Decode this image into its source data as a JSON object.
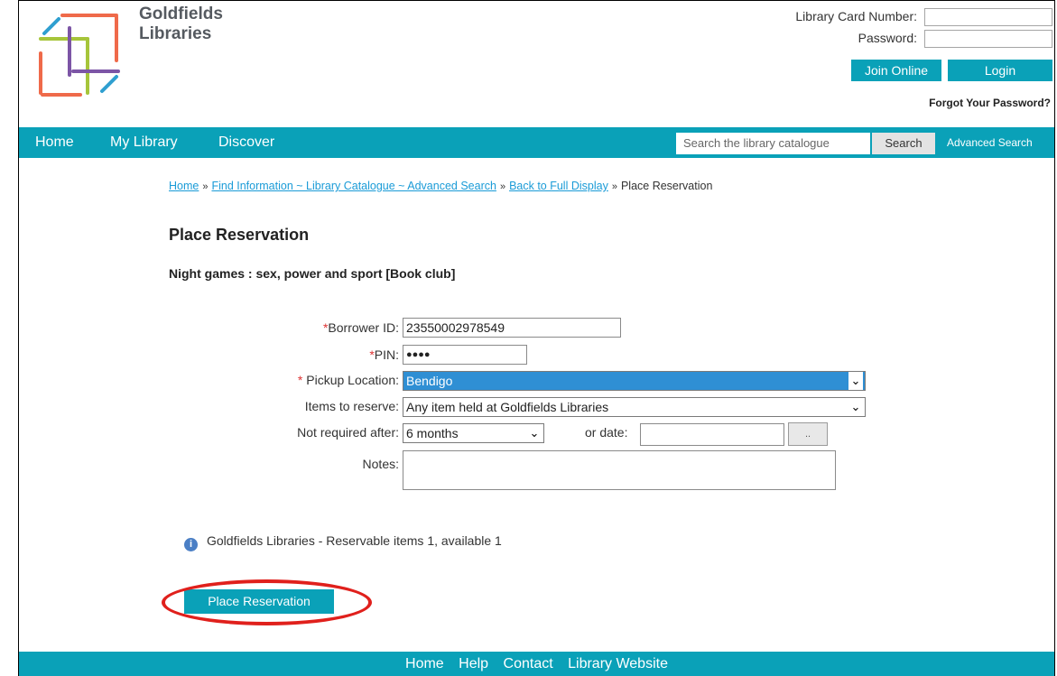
{
  "brand": {
    "line1": "Goldfields",
    "line2": "Libraries"
  },
  "login": {
    "card_label": "Library Card Number:",
    "password_label": "Password:",
    "card_value": "",
    "password_value": "",
    "join_label": "Join Online",
    "login_label": "Login",
    "forgot_label": "Forgot Your Password?"
  },
  "nav": {
    "items": [
      "Home",
      "My Library",
      "Discover"
    ],
    "search_placeholder": "Search the library catalogue",
    "search_button": "Search",
    "advanced": "Advanced Search"
  },
  "breadcrumb": {
    "home": "Home",
    "find": "Find Information ~ Library Catalogue ~ Advanced Search",
    "back": "Back to Full Display",
    "current": "Place Reservation",
    "sep": "»"
  },
  "page": {
    "title": "Place Reservation",
    "item_title": "Night games : sex, power and sport [Book club]"
  },
  "form": {
    "required_mark": "*",
    "borrower_label": "Borrower ID:",
    "borrower_value": "23550002978549",
    "pin_label": "PIN:",
    "pin_value": "●●●●",
    "pickup_label": " Pickup Location:",
    "pickup_value": "Bendigo",
    "items_label": "Items to reserve:",
    "items_value": "Any item held at Goldfields Libraries",
    "notreq_label": "Not required after:",
    "notreq_value": "6 months",
    "ordate_label": "or date:",
    "ordate_value": "",
    "date_button": "..",
    "notes_label": "Notes:",
    "notes_value": ""
  },
  "info": {
    "icon": "info-icon",
    "text": "Goldfields Libraries - Reservable items 1, available 1"
  },
  "action": {
    "place_label": "Place Reservation"
  },
  "footer": {
    "links": [
      "Home",
      "Help",
      "Contact",
      "Library Website"
    ]
  },
  "colors": {
    "accent": "#0aa1b8",
    "highlight": "#e0201c"
  }
}
